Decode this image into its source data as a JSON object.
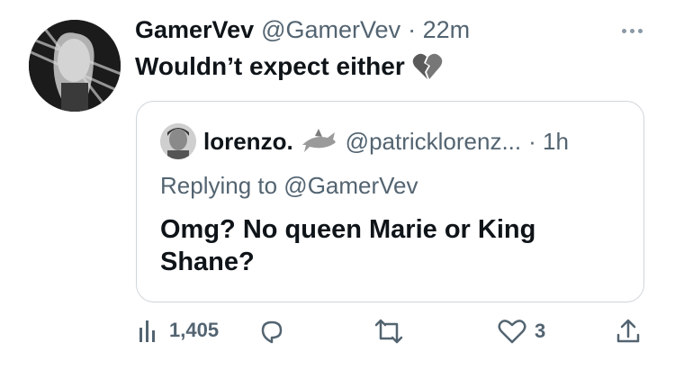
{
  "tweet": {
    "author_name": "GamerVev",
    "author_handle": "@GamerVev",
    "time": "· 22m",
    "text": "Wouldn’t expect either",
    "emoji_icon": "broken-heart-icon"
  },
  "quote": {
    "author_name": "lorenzo.",
    "author_emoji_icon": "shark-icon",
    "author_handle": "@patricklorenz...",
    "time": "· 1h",
    "replying_to": "Replying to @GamerVev",
    "text": "Omg? No queen Marie or King Shane?"
  },
  "actions": {
    "views": "1,405",
    "likes": "3"
  }
}
